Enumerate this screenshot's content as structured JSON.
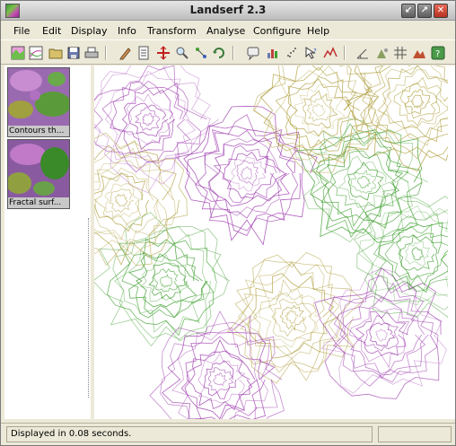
{
  "window": {
    "title": "Landserf 2.3"
  },
  "menubar": {
    "items": [
      {
        "label": "File"
      },
      {
        "label": "Edit"
      },
      {
        "label": "Display"
      },
      {
        "label": "Info"
      },
      {
        "label": "Transform"
      },
      {
        "label": "Analyse"
      },
      {
        "label": "Configure"
      },
      {
        "label": "Help"
      }
    ]
  },
  "toolbar": {
    "buttons": [
      "new-raster-icon",
      "new-vector-icon",
      "open-folder-icon",
      "save-icon",
      "print-icon",
      "pencil-edit-icon",
      "edit-attributes-icon",
      "move-icon",
      "zoom-icon",
      "zoom-area-icon",
      "refresh-icon",
      "query-icon",
      "histogram-icon",
      "scatterplot-icon",
      "query-pointer-icon",
      "profile-icon",
      "slope-icon",
      "peaks-icon",
      "grid-icon",
      "terrain-icon",
      "help-icon"
    ]
  },
  "sidebar": {
    "thumbnails": [
      {
        "label": "Contours th..."
      },
      {
        "label": "Fractal surf..."
      }
    ]
  },
  "status": {
    "message": "Displayed in 0.08 seconds."
  },
  "colors": {
    "accent_purple": "#a040b0",
    "accent_green": "#40a030",
    "accent_olive": "#b0a040"
  }
}
